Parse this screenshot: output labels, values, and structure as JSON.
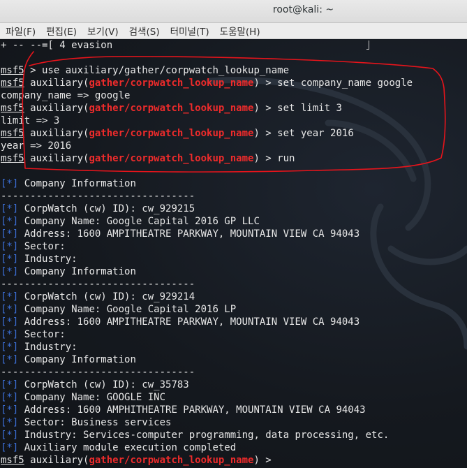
{
  "window": {
    "title": "root@kali: ~"
  },
  "menu": [
    "파일(F)",
    "편집(E)",
    "보기(V)",
    "검색(S)",
    "터미널(T)",
    "도움말(H)"
  ],
  "colors": {
    "module": "#ee2b2b",
    "status": "#3c6fd6",
    "text": "#e8e8e8",
    "annotation": "#e8141b"
  },
  "terminal": {
    "lines": [
      [
        {
          "t": "+ -- --=[ 4 evasion"
        }
      ],
      [
        {
          "t": ""
        }
      ],
      [
        {
          "t": "msf5",
          "c": "prompt"
        },
        {
          "t": " > use auxiliary/gather/corpwatch_lookup_name"
        }
      ],
      [
        {
          "t": "msf5",
          "c": "prompt"
        },
        {
          "t": " auxiliary("
        },
        {
          "t": "gather/corpwatch_lookup_name",
          "c": "mod"
        },
        {
          "t": ") > set company_name google"
        }
      ],
      [
        {
          "t": "company_name => google"
        }
      ],
      [
        {
          "t": "msf5",
          "c": "prompt"
        },
        {
          "t": " auxiliary("
        },
        {
          "t": "gather/corpwatch_lookup_name",
          "c": "mod"
        },
        {
          "t": ") > set limit 3"
        }
      ],
      [
        {
          "t": "limit => 3"
        }
      ],
      [
        {
          "t": "msf5",
          "c": "prompt"
        },
        {
          "t": " auxiliary("
        },
        {
          "t": "gather/corpwatch_lookup_name",
          "c": "mod"
        },
        {
          "t": ") > set year 2016"
        }
      ],
      [
        {
          "t": "year => 2016"
        }
      ],
      [
        {
          "t": "msf5",
          "c": "prompt"
        },
        {
          "t": " auxiliary("
        },
        {
          "t": "gather/corpwatch_lookup_name",
          "c": "mod"
        },
        {
          "t": ") > run"
        }
      ],
      [
        {
          "t": ""
        }
      ],
      [
        {
          "t": "[*]",
          "c": "star"
        },
        {
          "t": " Company Information"
        }
      ],
      [
        {
          "t": "---------------------------------"
        }
      ],
      [
        {
          "t": "[*]",
          "c": "star"
        },
        {
          "t": " CorpWatch (cw) ID): cw_929215"
        }
      ],
      [
        {
          "t": "[*]",
          "c": "star"
        },
        {
          "t": " Company Name: Google Capital 2016 GP LLC"
        }
      ],
      [
        {
          "t": "[*]",
          "c": "star"
        },
        {
          "t": " Address: 1600 AMPITHEATRE PARKWAY, MOUNTAIN VIEW CA 94043"
        }
      ],
      [
        {
          "t": "[*]",
          "c": "star"
        },
        {
          "t": " Sector:"
        }
      ],
      [
        {
          "t": "[*]",
          "c": "star"
        },
        {
          "t": " Industry:"
        }
      ],
      [
        {
          "t": "[*]",
          "c": "star"
        },
        {
          "t": " Company Information"
        }
      ],
      [
        {
          "t": "---------------------------------"
        }
      ],
      [
        {
          "t": "[*]",
          "c": "star"
        },
        {
          "t": " CorpWatch (cw) ID): cw_929214"
        }
      ],
      [
        {
          "t": "[*]",
          "c": "star"
        },
        {
          "t": " Company Name: Google Capital 2016 LP"
        }
      ],
      [
        {
          "t": "[*]",
          "c": "star"
        },
        {
          "t": " Address: 1600 AMPITHEATRE PARKWAY, MOUNTAIN VIEW CA 94043"
        }
      ],
      [
        {
          "t": "[*]",
          "c": "star"
        },
        {
          "t": " Sector:"
        }
      ],
      [
        {
          "t": "[*]",
          "c": "star"
        },
        {
          "t": " Industry:"
        }
      ],
      [
        {
          "t": "[*]",
          "c": "star"
        },
        {
          "t": " Company Information"
        }
      ],
      [
        {
          "t": "---------------------------------"
        }
      ],
      [
        {
          "t": "[*]",
          "c": "star"
        },
        {
          "t": " CorpWatch (cw) ID): cw_35783"
        }
      ],
      [
        {
          "t": "[*]",
          "c": "star"
        },
        {
          "t": " Company Name: GOOGLE INC"
        }
      ],
      [
        {
          "t": "[*]",
          "c": "star"
        },
        {
          "t": " Address: 1600 AMPHITHEATRE PARKWAY, MOUNTAIN VIEW CA 94043"
        }
      ],
      [
        {
          "t": "[*]",
          "c": "star"
        },
        {
          "t": " Sector: Business services"
        }
      ],
      [
        {
          "t": "[*]",
          "c": "star"
        },
        {
          "t": " Industry: Services-computer programming, data processing, etc."
        }
      ],
      [
        {
          "t": "[*]",
          "c": "star"
        },
        {
          "t": " Auxiliary module execution completed"
        }
      ],
      [
        {
          "t": "msf5",
          "c": "prompt"
        },
        {
          "t": " auxiliary("
        },
        {
          "t": "gather/corpwatch_lookup_name",
          "c": "mod"
        },
        {
          "t": ") > "
        }
      ]
    ]
  }
}
